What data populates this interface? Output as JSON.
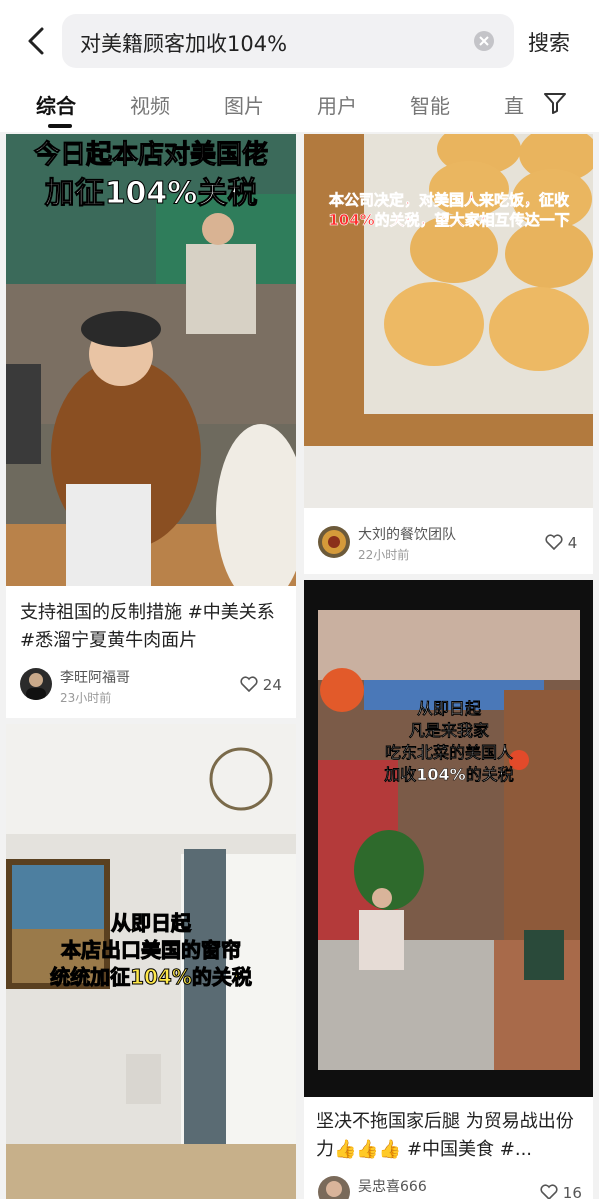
{
  "search": {
    "query": "对美籍顾客加收104%",
    "button_label": "搜索"
  },
  "tabs": [
    "综合",
    "视频",
    "图片",
    "用户",
    "智能",
    "直"
  ],
  "posts": [
    {
      "image_text_top": "今日起本店对美国佬",
      "image_text": "加征104%关税",
      "caption": "支持祖国的反制措施 #中美关系 #悉溜宁夏黄牛肉面片",
      "author": "李旺阿福哥",
      "time": "23小时前",
      "likes": "24"
    },
    {
      "image_text": "本公司决定，对美国人来吃饭，征收104%的关税，望大家相互传达一下",
      "author": "大刘的餐饮团队",
      "time": "22小时前",
      "likes": "4"
    },
    {
      "image_text_lines": [
        "从即日起",
        "凡是来我家",
        "吃东北菜的美国人",
        "加收104%的关税"
      ],
      "caption": "坚决不拖国家后腿 为贸易战出份力👍👍👍 #中国美食 #...",
      "author": "吴忠喜666",
      "likes": "16"
    },
    {
      "image_text_lines": [
        "从即日起",
        "本店出口美国的窗帘",
        "统统加征104%的关税"
      ]
    }
  ]
}
